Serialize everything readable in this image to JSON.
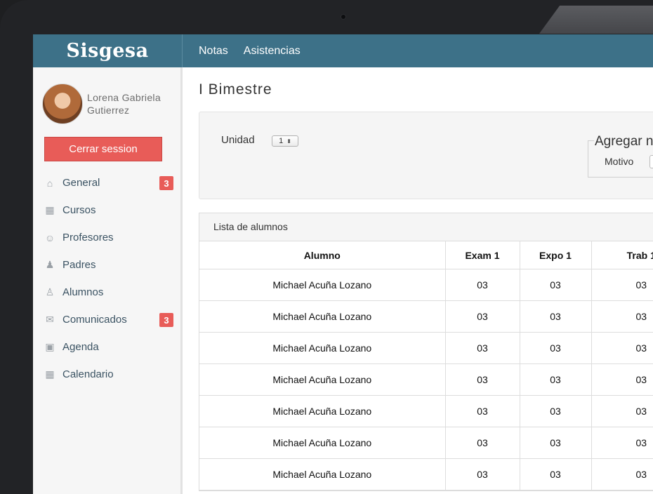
{
  "app": {
    "brand": "Sisgesa"
  },
  "topnav": [
    {
      "label": "Notas"
    },
    {
      "label": "Asistencias"
    }
  ],
  "user": {
    "first_line": "Lorena Gabriela",
    "second_line": "Gutierrez"
  },
  "sidebar": {
    "logout_label": "Cerrar session",
    "items": [
      {
        "label": "General",
        "icon": "home-icon",
        "badge": "3"
      },
      {
        "label": "Cursos",
        "icon": "calendar-icon",
        "badge": ""
      },
      {
        "label": "Profesores",
        "icon": "teacher-icon",
        "badge": ""
      },
      {
        "label": "Padres",
        "icon": "parent-icon",
        "badge": ""
      },
      {
        "label": "Alumnos",
        "icon": "students-icon",
        "badge": ""
      },
      {
        "label": "Comunicados",
        "icon": "envelope-icon",
        "badge": "3"
      },
      {
        "label": "Agenda",
        "icon": "address-book-icon",
        "badge": ""
      },
      {
        "label": "Calendario",
        "icon": "calendar-icon",
        "badge": ""
      }
    ]
  },
  "main": {
    "title": "I Bimestre",
    "filter": {
      "unidad_label": "Unidad",
      "unidad_value": "1",
      "agregar_legend": "Agregar no",
      "motivo_label": "Motivo"
    },
    "panel": {
      "title": "Lista de alumnos",
      "columns": [
        "Alumno",
        "Exam 1",
        "Expo 1",
        "Trab 1"
      ],
      "rows": [
        [
          "Michael Acuña Lozano",
          "03",
          "03",
          "03"
        ],
        [
          "Michael Acuña Lozano",
          "03",
          "03",
          "03"
        ],
        [
          "Michael Acuña Lozano",
          "03",
          "03",
          "03"
        ],
        [
          "Michael Acuña Lozano",
          "03",
          "03",
          "03"
        ],
        [
          "Michael Acuña Lozano",
          "03",
          "03",
          "03"
        ],
        [
          "Michael Acuña Lozano",
          "03",
          "03",
          "03"
        ],
        [
          "Michael Acuña Lozano",
          "03",
          "03",
          "03"
        ]
      ]
    }
  },
  "colors": {
    "header_bg": "#3d7188",
    "accent_red": "#e85c58",
    "sidebar_bg": "#f6f6f6"
  }
}
